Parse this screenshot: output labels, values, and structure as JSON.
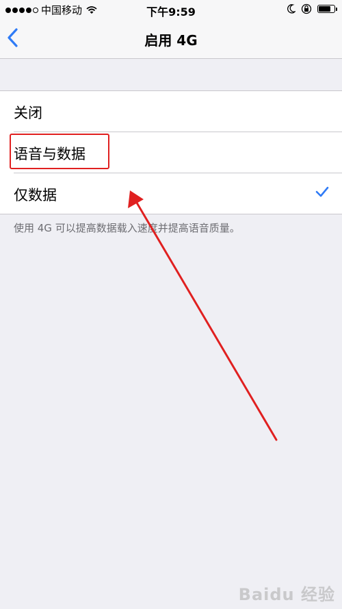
{
  "status_bar": {
    "carrier": "中国移动",
    "time": "下午9:59"
  },
  "nav": {
    "title": "启用 4G",
    "back_icon": "chevron-left-icon"
  },
  "options": [
    {
      "label": "关闭",
      "selected": false
    },
    {
      "label": "语音与数据",
      "selected": false
    },
    {
      "label": "仅数据",
      "selected": true
    }
  ],
  "footer_note": "使用 4G 可以提高数据载入速度并提高语音质量。",
  "colors": {
    "accent": "#2f7bf6",
    "highlight": "#e02020",
    "background": "#efeff4"
  },
  "watermark": "Baidu 经验"
}
